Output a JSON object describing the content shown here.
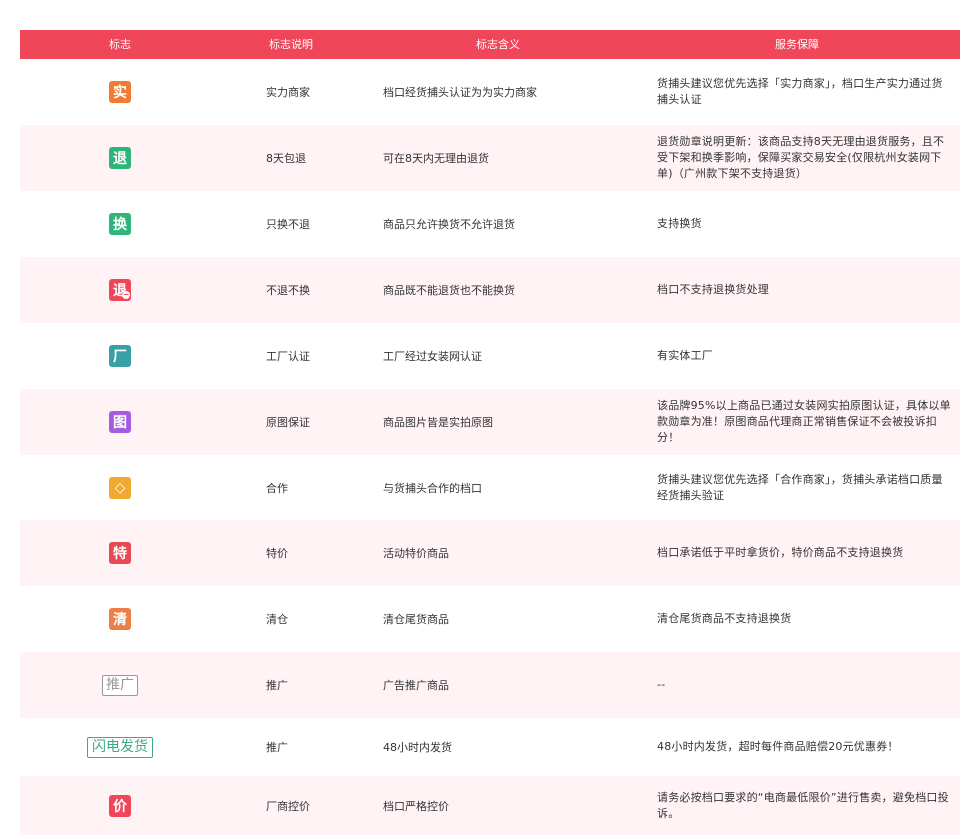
{
  "header": {
    "col_icon": "标志",
    "col_name": "标志说明",
    "col_meaning": "标志含义",
    "col_service": "服务保障"
  },
  "colors": {
    "header_bg": "#f0465a",
    "row_alt_bg": "#fff3f5"
  },
  "rows": [
    {
      "icon_text": "实",
      "icon_name": "shili-badge-icon",
      "icon_color": "#f07c32",
      "name": "实力商家",
      "meaning": "档口经货捕头认证为为实力商家",
      "service": "货捕头建议您优先选择「实力商家」，档口生产实力通过货捕头认证"
    },
    {
      "icon_text": "退",
      "icon_name": "tui-badge-icon",
      "icon_color": "#2fb57a",
      "name": "8天包退",
      "meaning": "可在8天内无理由退货",
      "service": "退货勋章说明更新：该商品支持8天无理由退货服务，且不受下架和换季影响，保障买家交易安全(仅限杭州女装网下单)（广州款下架不支持退货）"
    },
    {
      "icon_text": "换",
      "icon_name": "huan-badge-icon",
      "icon_color": "#2fb57a",
      "name": "只换不退",
      "meaning": "商品只允许换货不允许退货",
      "service": "支持换货"
    },
    {
      "icon_text": "退",
      "icon_name": "no-return-badge-icon",
      "icon_color": "#f0465a",
      "name": "不退不换",
      "meaning": "商品既不能退货也不能换货",
      "service": "档口不支持退换货处理"
    },
    {
      "icon_text": "厂",
      "icon_name": "factory-badge-icon",
      "icon_color": "#3aa0a8",
      "name": "工厂认证",
      "meaning": "工厂经过女装网认证",
      "service": "有实体工厂"
    },
    {
      "icon_text": "图",
      "icon_name": "photo-badge-icon",
      "icon_color": "#a55de0",
      "name": "原图保证",
      "meaning": "商品图片皆是实拍原图",
      "service": "该品牌95%以上商品已通过女装网实拍原图认证，具体以单款勋章为准！原图商品代理商正常销售保证不会被投诉扣分！"
    },
    {
      "icon_text": "◇",
      "icon_name": "handshake-badge-icon",
      "icon_color": "#f0a830",
      "name": "合作",
      "meaning": "与货捕头合作的档口",
      "service": "货捕头建议您优先选择「合作商家」，货捕头承诺档口质量经货捕头验证"
    },
    {
      "icon_text": "特",
      "icon_name": "sale-badge-icon",
      "icon_color": "#e84a55",
      "name": "特价",
      "meaning": "活动特价商品",
      "service": "档口承诺低于平时拿货价，特价商品不支持退换货"
    },
    {
      "icon_text": "清",
      "icon_name": "clearance-badge-icon",
      "icon_color": "#ec7f45",
      "name": "清仓",
      "meaning": "清仓尾货商品",
      "service": "清仓尾货商品不支持退换货"
    },
    {
      "icon_text": "推广",
      "icon_name": "promo-badge-icon",
      "icon_color": "#999999",
      "name": "推广",
      "meaning": "广告推广商品",
      "service": "--"
    },
    {
      "icon_text": "闪电发货",
      "icon_name": "fast-ship-badge-icon",
      "icon_color": "#3aa889",
      "name": "推广",
      "meaning": "48小时内发货",
      "service": "48小时内发货，超时每件商品赔偿20元优惠券！"
    },
    {
      "icon_text": "价",
      "icon_name": "price-control-badge-icon",
      "icon_color": "#f0465a",
      "name": "厂商控价",
      "meaning": "档口严格控价",
      "service": "请务必按档口要求的“电商最低限价”进行售卖，避免档口投诉。"
    }
  ]
}
